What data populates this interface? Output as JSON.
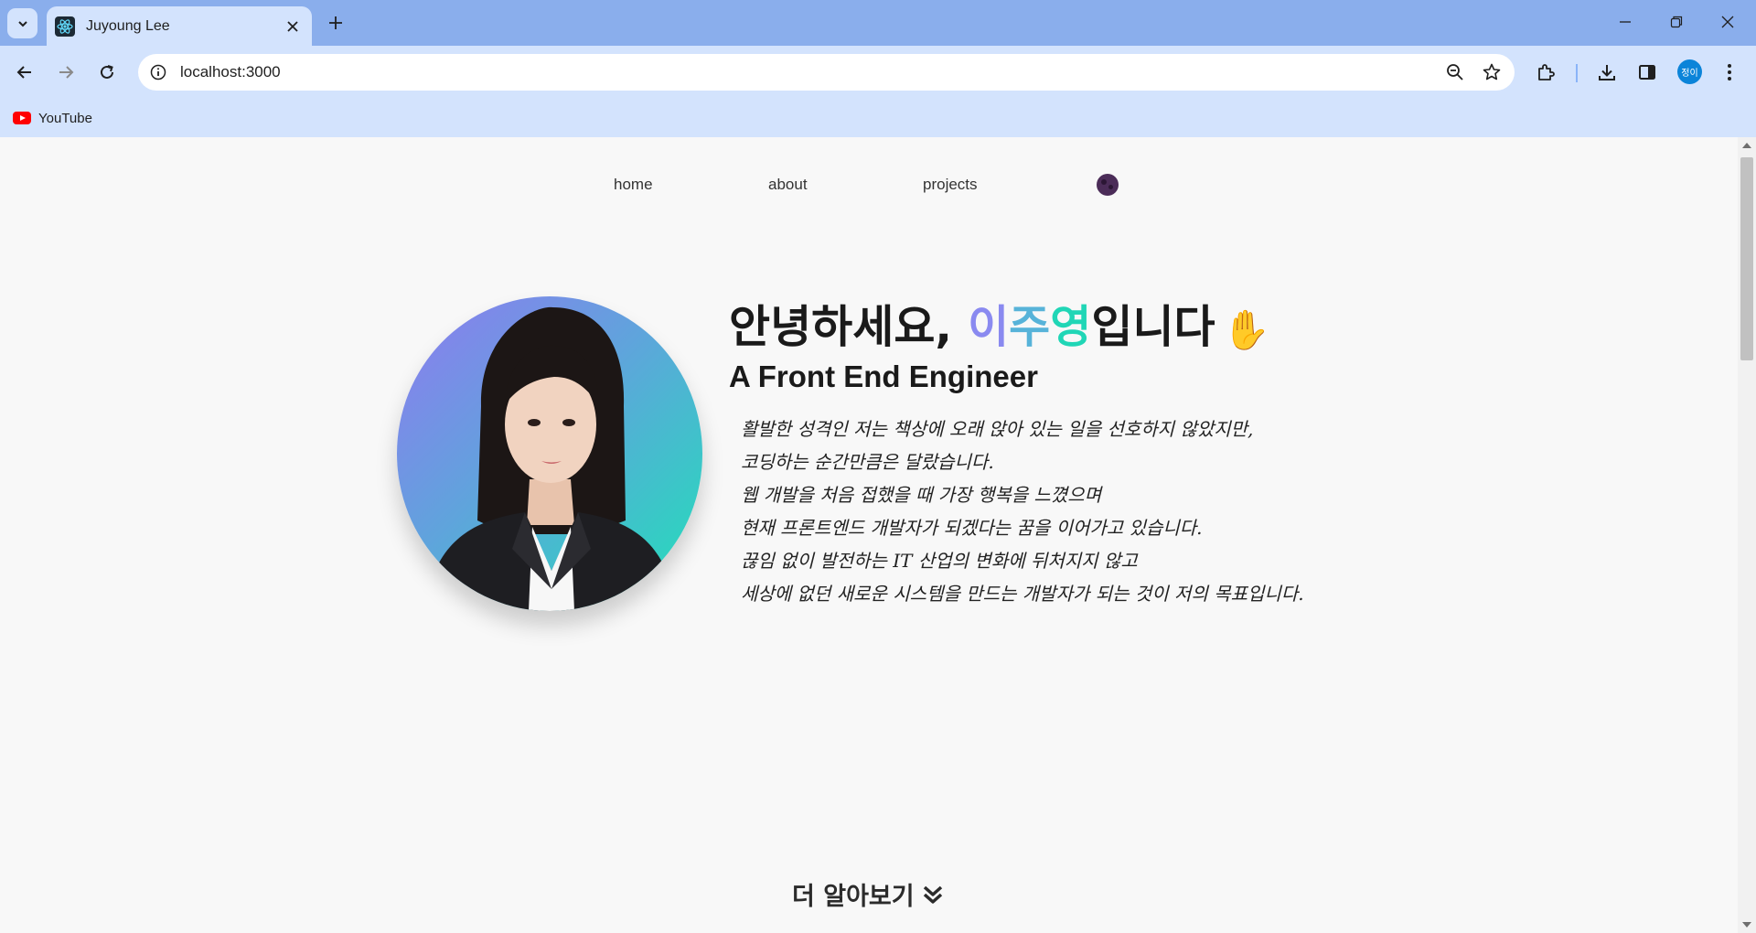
{
  "browser": {
    "tab": {
      "title": "Juyoung Lee",
      "favicon": "react-icon"
    },
    "url": "localhost:3000",
    "bookmarks": [
      {
        "label": "YouTube",
        "icon": "youtube-icon"
      }
    ],
    "profile_initials": "정이"
  },
  "nav": {
    "links": [
      {
        "label": "home"
      },
      {
        "label": "about"
      },
      {
        "label": "projects"
      }
    ],
    "theme_toggle_icon": "theme-toggle-icon"
  },
  "hero": {
    "greeting_before": "안녕하세요, ",
    "name_part1": "이",
    "name_part2": "주",
    "name_part3": "영",
    "greeting_after": "입니다",
    "wave_emoji": "✋",
    "subtitle": "A Front End Engineer",
    "intro_lines": [
      "활발한 성격인 저는 책상에 오래 앉아 있는 일을 선호하지 않았지만,",
      "코딩하는 순간만큼은 달랐습니다.",
      "웹 개발을 처음 접했을 때 가장 행복을 느꼈으며",
      "현재 프론트엔드 개발자가 되겠다는 꿈을 이어가고 있습니다.",
      "끊임 없이 발전하는 IT 산업의 변화에 뒤처지지 않고",
      "세상에 없던 새로운 시스템을 만드는 개발자가 되는 것이 저의 목표입니다."
    ],
    "name_colors": [
      "#8a8af0",
      "#57b3d9",
      "#20d6b6"
    ]
  },
  "more": {
    "label": "더 알아보기",
    "icon": "double-chevron-down-icon"
  }
}
